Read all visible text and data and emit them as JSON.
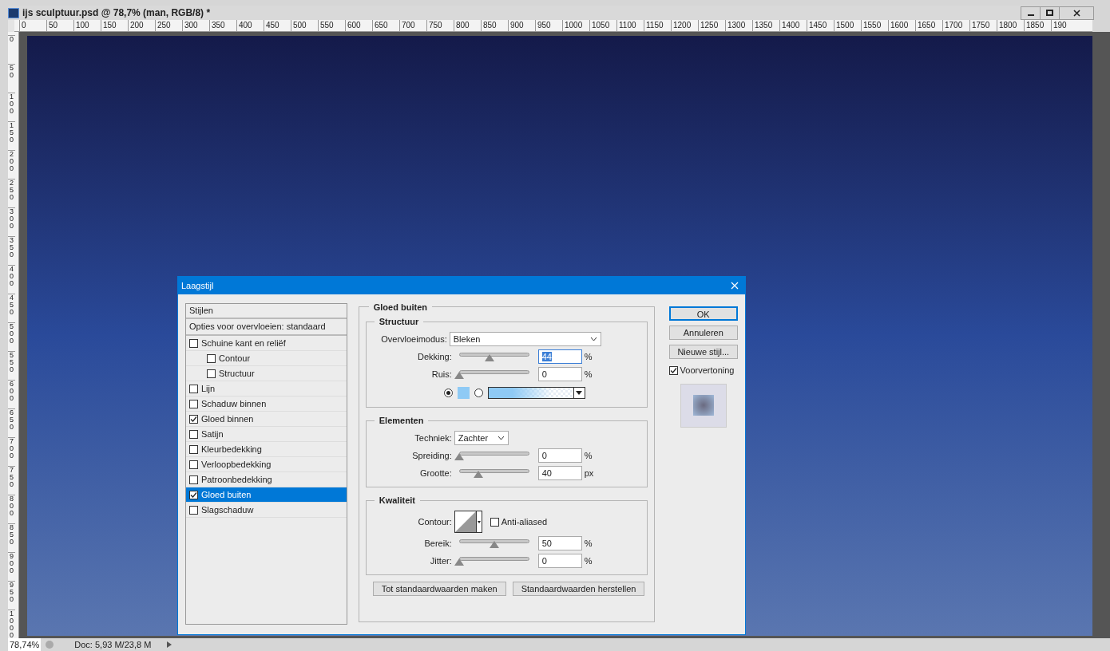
{
  "window": {
    "title": "ijs sculptuur.psd @ 78,7% (man, RGB/8) *"
  },
  "ruler_h": [
    "0",
    "50",
    "100",
    "150",
    "200",
    "250",
    "300",
    "350",
    "400",
    "450",
    "500",
    "550",
    "600",
    "650",
    "700",
    "750",
    "800",
    "850",
    "900",
    "950",
    "1000",
    "1050",
    "1100",
    "1150",
    "1200",
    "1250",
    "1300",
    "1350",
    "1400",
    "1450",
    "1500",
    "1550",
    "1600",
    "1650",
    "1700",
    "1750",
    "1800",
    "1850",
    "190"
  ],
  "ruler_v": [
    "0",
    "50",
    "100",
    "150",
    "200",
    "250",
    "300",
    "350",
    "400",
    "450",
    "500",
    "550",
    "600",
    "650",
    "700",
    "750",
    "800",
    "850",
    "900",
    "950",
    "1000"
  ],
  "dialog": {
    "title": "Laagstijl",
    "styles_header": "Stijlen",
    "blend_options": "Opties voor overvloeien: standaard",
    "styles": [
      {
        "label": "Schuine kant en reliëf",
        "checked": false,
        "selected": false,
        "children": [
          {
            "label": "Contour",
            "checked": false,
            "selected": false
          },
          {
            "label": "Structuur",
            "checked": false,
            "selected": false
          }
        ]
      },
      {
        "label": "Lijn",
        "checked": false,
        "selected": false
      },
      {
        "label": "Schaduw binnen",
        "checked": false,
        "selected": false
      },
      {
        "label": "Gloed binnen",
        "checked": true,
        "selected": false
      },
      {
        "label": "Satijn",
        "checked": false,
        "selected": false
      },
      {
        "label": "Kleurbedekking",
        "checked": false,
        "selected": false
      },
      {
        "label": "Verloopbedekking",
        "checked": false,
        "selected": false
      },
      {
        "label": "Patroonbedekking",
        "checked": false,
        "selected": false
      },
      {
        "label": "Gloed buiten",
        "checked": true,
        "selected": true
      },
      {
        "label": "Slagschaduw",
        "checked": false,
        "selected": false
      }
    ],
    "panel_title": "Gloed buiten",
    "structure": {
      "title": "Structuur",
      "blend_label": "Overvloeimodus:",
      "blend_value": "Bleken",
      "sliders": [
        {
          "label": "Dekking:",
          "value": "44",
          "unit": "%",
          "level": 0.44,
          "focused": true
        },
        {
          "label": "Ruis:",
          "value": "0",
          "unit": "%",
          "level": 0,
          "focused": false
        }
      ],
      "color_mode": [
        {
          "kind": "color",
          "selected": true,
          "color": "#8fcaf5"
        },
        {
          "kind": "gradient",
          "selected": false,
          "color": "#8fcaf5"
        }
      ]
    },
    "elements": {
      "title": "Elementen",
      "technique_label": "Techniek:",
      "technique_value": "Zachter",
      "sliders": [
        {
          "label": "Spreiding:",
          "value": "0",
          "unit": "%",
          "level": 0,
          "focused": false
        },
        {
          "label": "Grootte:",
          "value": "40",
          "unit": "px",
          "level": 0.27,
          "focused": false
        }
      ]
    },
    "quality": {
      "title": "Kwaliteit",
      "contour_label": "Contour:",
      "anti_aliased": {
        "label": "Anti-aliased",
        "checked": false
      },
      "sliders": [
        {
          "label": "Bereik:",
          "value": "50",
          "unit": "%",
          "level": 0.5,
          "focused": false
        },
        {
          "label": "Jitter:",
          "value": "0",
          "unit": "%",
          "level": 0,
          "focused": false
        }
      ]
    },
    "bottom_buttons": [
      "Tot standaardwaarden maken",
      "Standaardwaarden herstellen"
    ],
    "buttons": [
      {
        "label": "OK",
        "default": true
      },
      {
        "label": "Annuleren",
        "default": false
      },
      {
        "label": "Nieuwe stijl...",
        "default": false
      }
    ],
    "preview": {
      "label": "Voorvertoning",
      "checked": true
    }
  },
  "status_bar": {
    "zoom": "78,74%",
    "doc": "Doc: 5,93 M/23,8 M"
  }
}
